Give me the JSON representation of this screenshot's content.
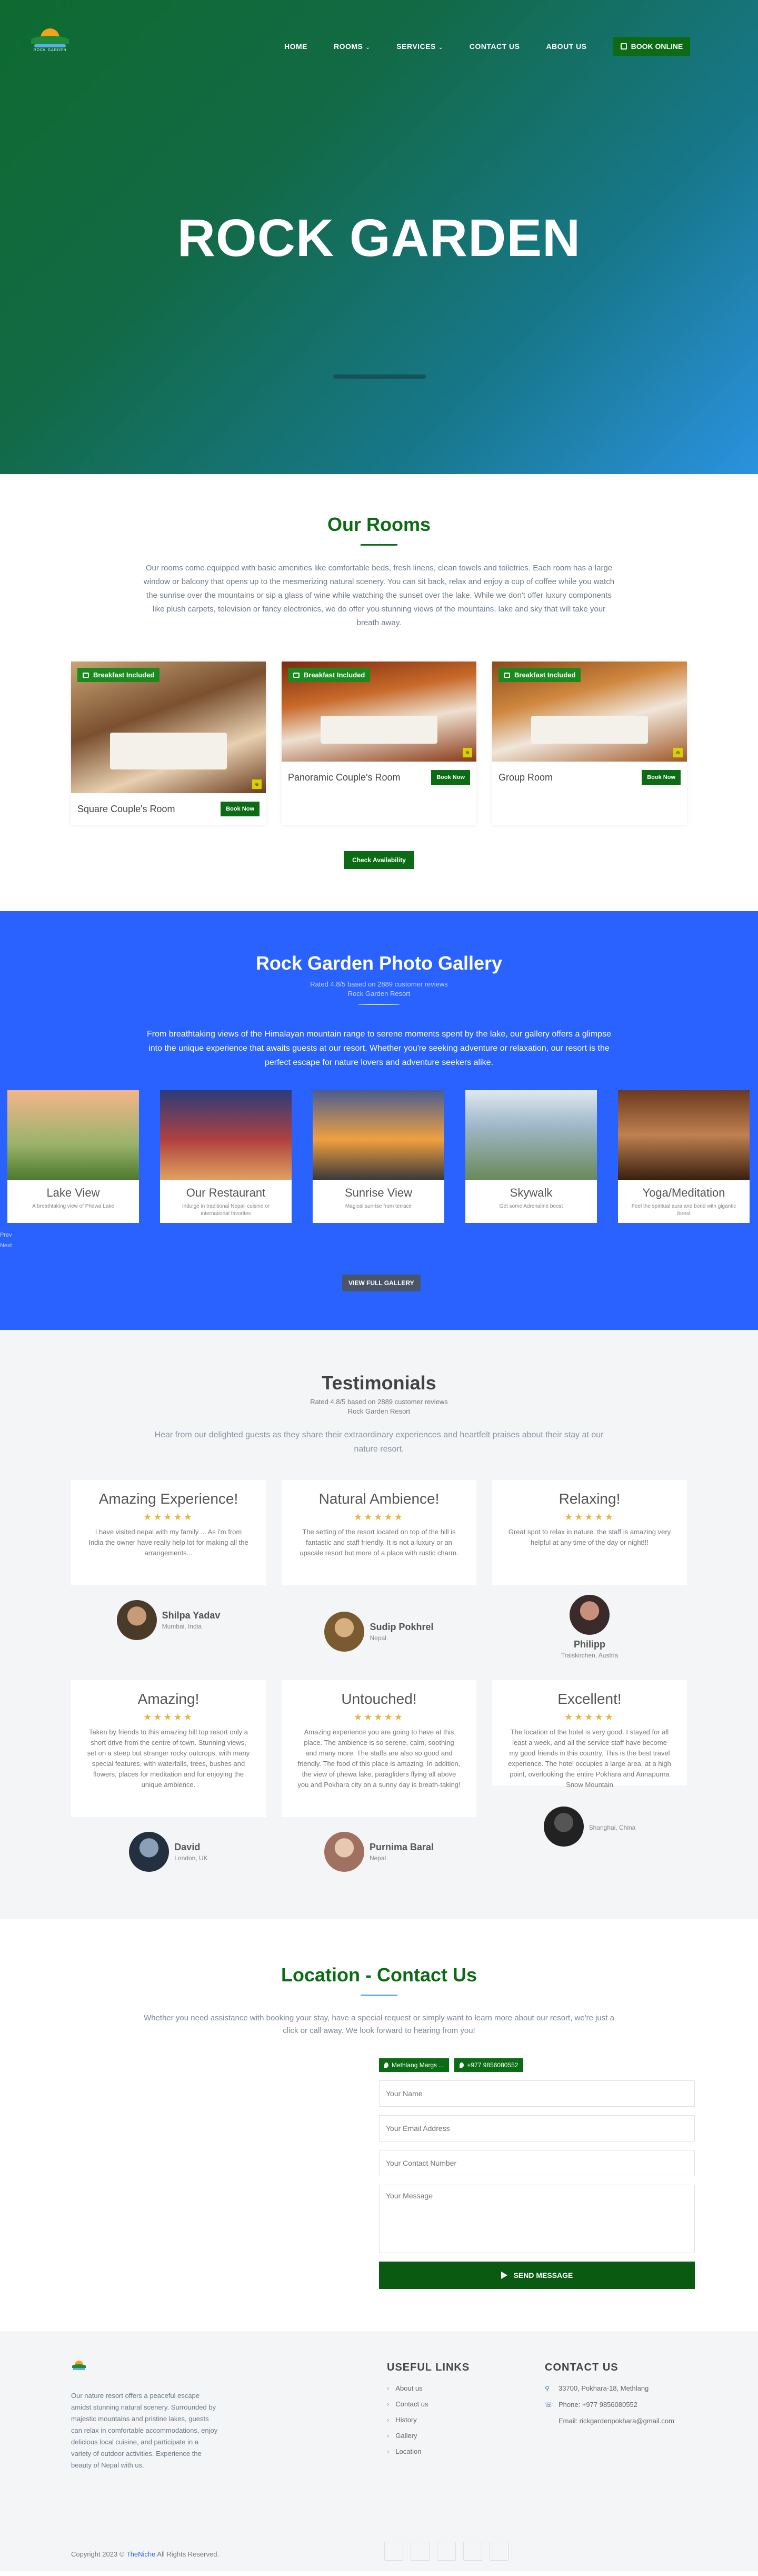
{
  "nav": {
    "logo_text": "ROCK GARDEN",
    "items": [
      {
        "label": "HOME",
        "dropdown": false
      },
      {
        "label": "ROOMS",
        "dropdown": true
      },
      {
        "label": "SERVICES",
        "dropdown": true
      },
      {
        "label": "CONTACT US",
        "dropdown": false
      },
      {
        "label": "ABOUT US",
        "dropdown": false
      }
    ],
    "book_label": "BOOK ONLINE"
  },
  "hero": {
    "title": "ROCK GARDEN"
  },
  "rooms": {
    "title": "Our Rooms",
    "description": "Our rooms come equipped with basic amenities like comfortable beds, fresh linens, clean towels and toiletries. Each room has a large window or balcony that opens up to the mesmerizing natural scenery. You can sit back, relax and enjoy a cup of coffee while you watch the sunrise over the mountains or sip a glass of wine while watching the sunset over the lake. While we don't offer luxury components like plush carpets, television or fancy electronics, we do offer you stunning views of the mountains, lake and sky that will take your breath away.",
    "badge": "Breakfast Included",
    "book_label": "Book Now",
    "cards": [
      {
        "name": "Square Couple's Room"
      },
      {
        "name": "Panoramic Couple's Room"
      },
      {
        "name": "Group Room"
      }
    ],
    "availability_label": "Check Availability"
  },
  "gallery": {
    "title": "Rock Garden Photo Gallery",
    "sub1": "Rated 4.8/5 based on 2889 customer reviews",
    "sub2": "Rock Garden Resort",
    "description": "From breathtaking views of the Himalayan mountain range to serene moments spent by the lake, our gallery offers a glimpse into the unique experience that awaits guests at our resort. Whether you're seeking adventure or relaxation, our resort is the perfect escape for nature lovers and adventure seekers alike.",
    "items": [
      {
        "caption": "Lake View",
        "small": "A breathtaking view of Phewa Lake"
      },
      {
        "caption": "Our Restaurant",
        "small": "Indulge in traditional Nepali cuisine or international favorites"
      },
      {
        "caption": "Sunrise View",
        "small": "Magical sunrise from terrace"
      },
      {
        "caption": "Skywalk",
        "small": "Get some Adrenaline boost"
      },
      {
        "caption": "Yoga/Meditation",
        "small": "Feel the spiritual aura and bond with gigantic forest"
      }
    ],
    "prev": "Prev",
    "next": "Next",
    "button": "VIEW FULL GALLERY"
  },
  "testimonials": {
    "title": "Testimonials",
    "sub1": "Rated 4.8/5 based on 2889 customer reviews",
    "sub2": "Rock Garden Resort",
    "description": "Hear from our delighted guests as they share their extraordinary experiences and heartfelt praises about their stay at our nature resort.",
    "stars": "★★★★★",
    "items": [
      {
        "heading": "Amazing Experience!",
        "body": "I have visited nepal with my family ... As i'm from India the owner have really help lot for making all the arrangements...",
        "name": "Shilpa Yadav",
        "location": "Mumbai, India"
      },
      {
        "heading": "Natural Ambience!",
        "body": "The setting of the resort located on top of the hill is fantastic and staff friendly. It is not a luxury or an upscale resort but more of a place with rustic charm.",
        "name": "Sudip Pokhrel",
        "location": "Nepal"
      },
      {
        "heading": "Relaxing!",
        "body": "Great spot to relax in nature. the staff is amazing very helpful at any time of the day or night!!!",
        "name": "Philipp",
        "location": "Traiskirchen, Austria"
      },
      {
        "heading": "Amazing!",
        "body": "Taken by friends to this amazing hill top resort only a short drive from the centre of town. Stunning views, set on a steep but stranger rocky outcrops, with many special features, with waterfalls, trees, bushes and flowers, places for meditation and for enjoying the unique ambience.",
        "name": "David",
        "location": "London, UK"
      },
      {
        "heading": "Untouched!",
        "body": "Amazing experience you are going to have at this place. The ambience is so serene, calm, soothing and many more. The staffs are also so good and friendly. The food of this place is amazing. In addition, the view of phewa lake, paragliders flying all above you and Pokhara city on a sunny day is breath-taking!",
        "name": "Purnima Baral",
        "location": "Nepal"
      },
      {
        "heading": "Excellent!",
        "body": "The location of the hotel is very good. I stayed for all least a week, and all the service staff have become my good friends in this country. This is the best travel experience. The hotel occupies a large area, at a high point, overlooking the entire Pokhara and Annapurna Snow Mountain",
        "name": "",
        "location": "Shanghai, China"
      }
    ]
  },
  "contact": {
    "title": "Location - Contact Us",
    "description": "Whether you need assistance with booking your stay, have a special request or simply want to learn more about our resort, we're just a click or call away. We look forward to hearing from you!",
    "tag_location": "Methlang Margs ...",
    "tag_phone": "+977 9856080552",
    "name_placeholder": "Your Name",
    "email_placeholder": "Your Email Address",
    "number_placeholder": "Your Contact Number",
    "message_placeholder": "Your Message",
    "send_label": "SEND MESSAGE"
  },
  "footer": {
    "about": "Our nature resort offers a peaceful escape amidst stunning natural scenery. Surrounded by majestic mountains and pristine lakes, guests can relax in comfortable accommodations, enjoy delicious local cuisine, and participate in a variety of outdoor activities. Experience the beauty of Nepal with us.",
    "links_title": "USEFUL LINKS",
    "links": [
      "About us",
      "Contact us",
      "History",
      "Gallery",
      "Location"
    ],
    "contact_title": "CONTACT US",
    "address": "33700, Pokhara-18, Methlang",
    "phone": "Phone: +977 9856080552",
    "email": "Email: rickgardenpokhara@gmail.com",
    "copy_before": "Copyright 2023 © ",
    "copy_brand": "TheNiche",
    "copy_after": " All Rights Reserved."
  },
  "colors": {
    "brand_green": "#0b6c15",
    "gallery_blue": "#2962ff",
    "star": "#e8b440"
  }
}
